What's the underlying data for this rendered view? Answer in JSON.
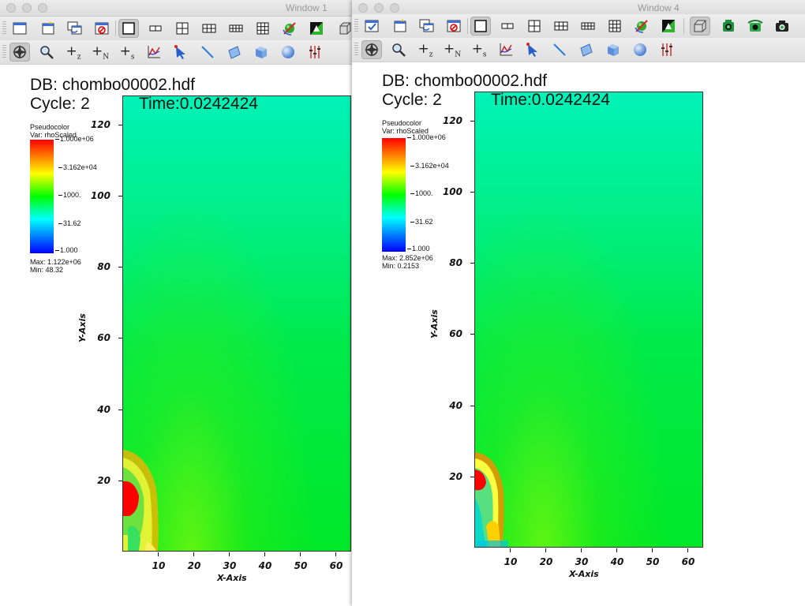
{
  "windows": [
    {
      "title": "Window 1",
      "db": "DB: chombo00002.hdf",
      "cycle": "Cycle: 2",
      "time": "Time:0.0242424",
      "legend": {
        "plot_type": "Pseudocolor",
        "var": "Var: rhoScaled",
        "ticks": [
          "1.000e+06",
          "3.162e+04",
          "1000.",
          "31.62",
          "1.000"
        ],
        "max": "Max:  1.122e+06",
        "min": "Min:  48.32"
      },
      "yticks": [
        "120",
        "100",
        "80",
        "60",
        "40",
        "20"
      ],
      "xticks": [
        "10",
        "20",
        "30",
        "40",
        "50",
        "60"
      ],
      "xlabel": "X-Axis",
      "ylabel": "Y-Axis"
    },
    {
      "title": "Window 4",
      "db": "DB: chombo00002.hdf",
      "cycle": "Cycle: 2",
      "time": "Time:0.0242424",
      "legend": {
        "plot_type": "Pseudocolor",
        "var": "Var: rhoScaled",
        "ticks": [
          "1.000e+06",
          "3.162e+04",
          "1000.",
          "31.62",
          "1.000"
        ],
        "max": "Max:  2.852e+06",
        "min": "Min:  0.2153"
      },
      "yticks": [
        "120",
        "100",
        "80",
        "60",
        "40",
        "20"
      ],
      "xticks": [
        "10",
        "20",
        "30",
        "40",
        "50",
        "60"
      ],
      "xlabel": "X-Axis",
      "ylabel": "Y-Axis"
    }
  ],
  "toolbar": {
    "row1": [
      "new-window-icon",
      "copy-window-icon",
      "clone-window-icon",
      "clear-window-icon",
      "layout-1x1-icon",
      "layout-1x2-icon",
      "layout-2x2-icon",
      "layout-2x3-icon",
      "layout-2x4-icon",
      "layout-3x3-icon",
      "spin-icon",
      "invert-background-icon",
      "view-3d-icon",
      "lock-view-icon",
      "lock-time-icon",
      "save-image-icon"
    ],
    "row2": [
      "navigate-icon",
      "zoom-icon",
      "zone-pick-icon",
      "node-pick-icon",
      "spreadsheet-pick-icon",
      "lineout-icon",
      "point-tool-icon",
      "line-tool-icon",
      "plane-tool-icon",
      "box-tool-icon",
      "sphere-tool-icon",
      "axis-restriction-icon"
    ],
    "row2_text": {
      "zone": "z",
      "node": "N",
      "spreadsheet": "s"
    }
  },
  "colors": {
    "colorbar": [
      "#ff0000",
      "#ffff00",
      "#00ff00",
      "#00ffff",
      "#0000ff"
    ],
    "background_field": "#00e840"
  }
}
